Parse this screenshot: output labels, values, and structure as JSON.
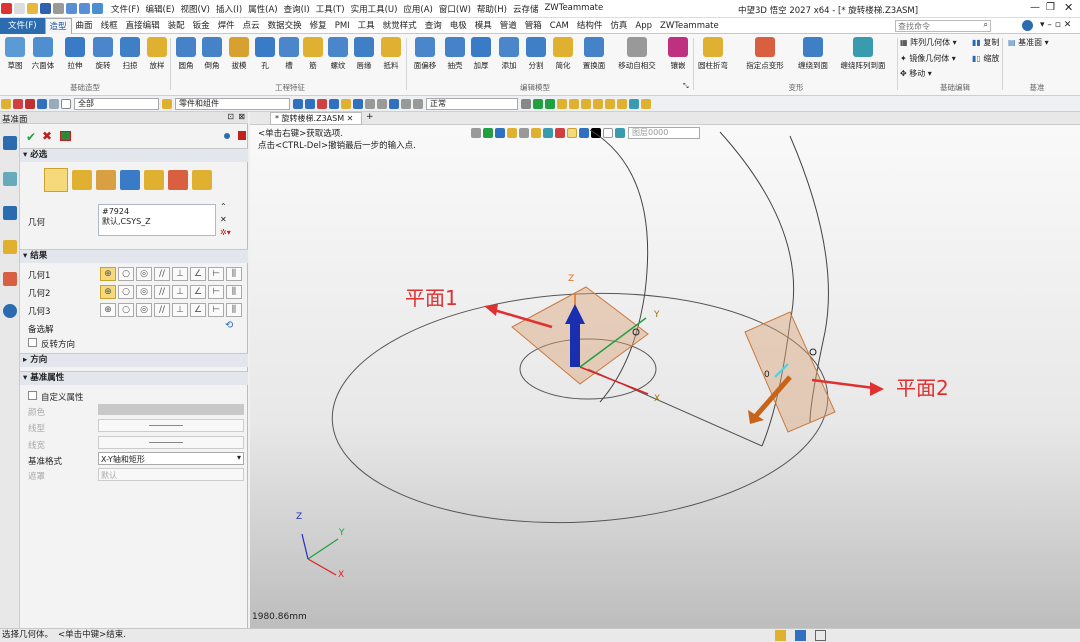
{
  "title": "中望3D 悟空 2027 x64 - [* 旋转楼梯.Z3ASM]",
  "menus": [
    "文件(F)",
    "编辑(E)",
    "视图(V)",
    "插入(I)",
    "属性(A)",
    "查询(I)",
    "工具(T)",
    "实用工具(U)",
    "应用(A)",
    "窗口(W)",
    "帮助(H)",
    "云存储",
    "ZWTeammate"
  ],
  "search_placeholder": "查找命令",
  "tabs": [
    "文件(F)",
    "造型",
    "曲面",
    "线框",
    "直接编辑",
    "装配",
    "钣金",
    "焊件",
    "点云",
    "数据交换",
    "修复",
    "PMI",
    "工具",
    "就觉样式",
    "查询",
    "电极",
    "模具",
    "管道",
    "管箱",
    "CAM",
    "结构件",
    "仿真",
    "App",
    "ZWTeammate"
  ],
  "ribbon": {
    "buttons": [
      "草图",
      "六面体",
      "拉伸",
      "旋转",
      "扫掠",
      "放样",
      "圆角",
      "倒角",
      "拔模",
      "孔",
      "槽",
      "筋",
      "螺纹",
      "唇缘",
      "抵料",
      "面偏移",
      "抽壳",
      "加厚",
      "添加",
      "分割",
      "简化",
      "置换面",
      "移动自相交",
      "镶嵌",
      "圆柱折弯",
      "指定点变形",
      "缠绕到面",
      "缠绕阵列到面"
    ],
    "side_items": [
      "阵列几何体",
      "复制",
      "镜像几何体",
      "缩放",
      "移动",
      "基准面"
    ],
    "groups": [
      "基础造型",
      "工程特征",
      "编辑模型",
      "变形",
      "基础编辑",
      "基准"
    ]
  },
  "toolbar2": {
    "filter": "全部",
    "scope": "零件和组件",
    "mode": "正常"
  },
  "panel": {
    "title": "基准面",
    "section_required": "必选",
    "geometry_label": "几何",
    "geometry_value1": "#7924",
    "geometry_value2": "默认,CSYS_Z",
    "section_result": "结果",
    "geo1": "几何1",
    "geo2": "几何2",
    "geo3": "几何3",
    "alt_solution": "备选解",
    "reverse": "反转方向",
    "section_direction": "方向",
    "section_attr": "基准属性",
    "custom_attr": "自定义属性",
    "color": "颜色",
    "line_type": "线型",
    "line_width": "线宽",
    "datum_style": "基准格式",
    "datum_style_value": "X-Y轴和矩形",
    "hide": "遮罩",
    "hide_value": "默认"
  },
  "doc_tab": "* 旋转楼梯.Z3ASM",
  "prompt1": "<单击右键>获取选项.",
  "prompt2": "点击<CTRL-Del>撤销最后一步的输入点.",
  "layer": "图层0000",
  "annotations": {
    "plane1": "平面1",
    "plane2": "平面2"
  },
  "scale_text": "1980.86mm",
  "axes": {
    "x": "X",
    "y": "Y",
    "z": "Z"
  },
  "zero_label": "0",
  "status": {
    "left": "选择几何体。",
    "right": "<单击中键>结束."
  },
  "colors": {
    "accent": "#2b6cb0",
    "annotation": "#e03030",
    "axis_x": "#e02020",
    "axis_y": "#20a040",
    "axis_z": "#2030c0",
    "plane_fill": "#d9a57a"
  }
}
